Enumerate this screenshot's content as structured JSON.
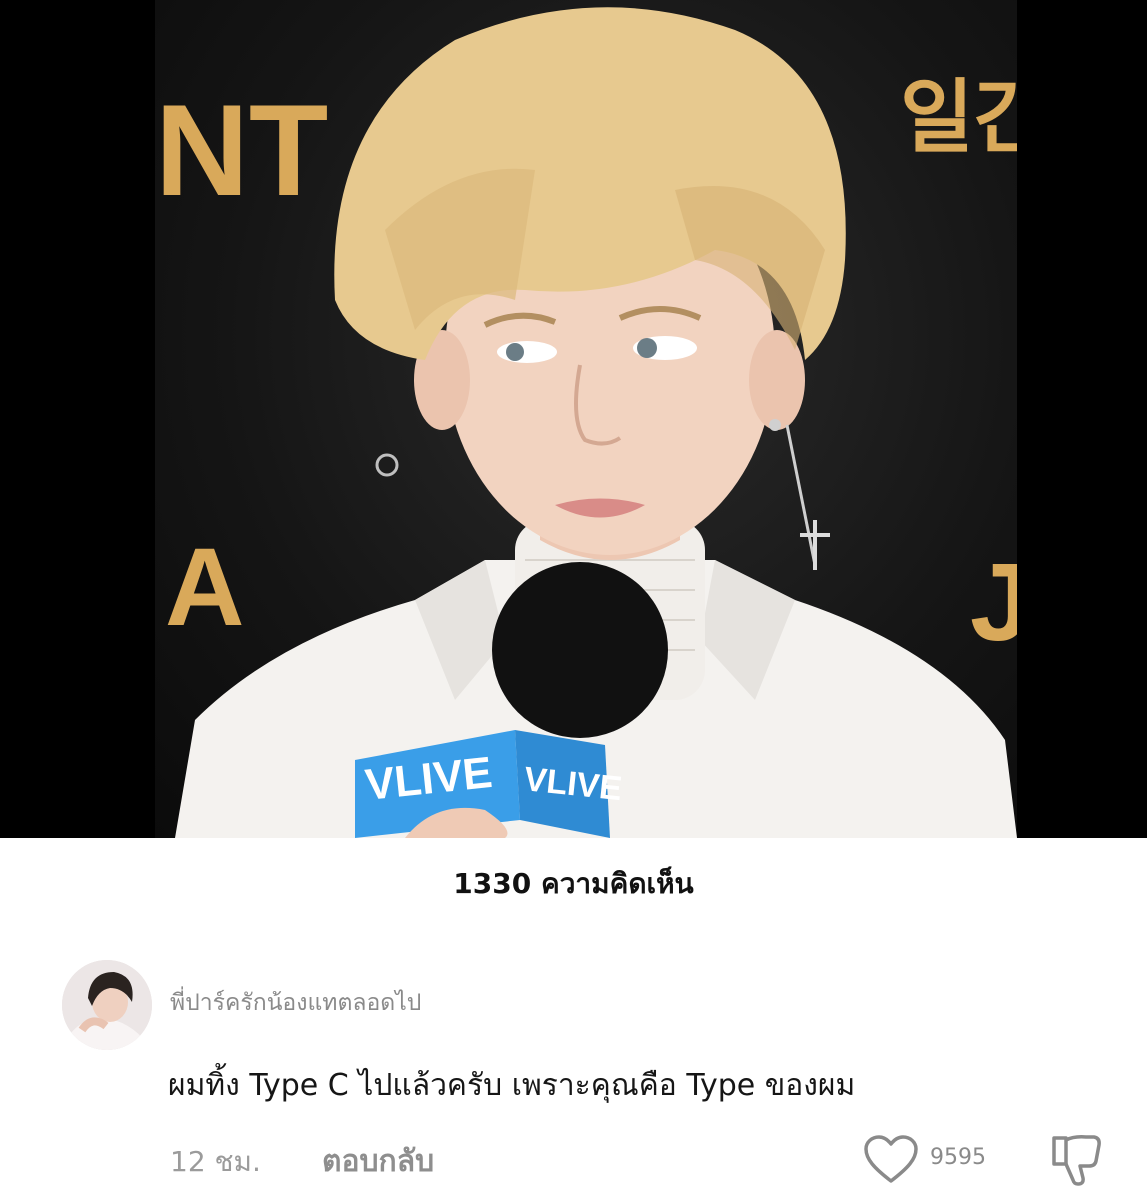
{
  "media": {
    "overlay_texts": [
      "NT",
      "일간",
      "A",
      "J",
      "VLIVE",
      "VLIVE"
    ]
  },
  "comments": {
    "count_label": "1330 ความคิดเห็น"
  },
  "comment": {
    "username": "พี่ปาร์ครักน้องแทตลอดไป",
    "text": "ผมทิ้ง Type C ไปแล้วครับ เพราะคุณคือ Type ของผม",
    "time": "12 ชม.",
    "reply_label": "ตอบกลับ",
    "like_count": "9595"
  },
  "colors": {
    "background": "#ffffff",
    "media_band": "#000000",
    "hair": "#e7c98f",
    "vlive_blue": "#3a9ee8",
    "gold_text": "#d9a95a"
  },
  "icons": {
    "like": "heart-outline-icon",
    "dislike": "thumbs-down-outline-icon"
  }
}
